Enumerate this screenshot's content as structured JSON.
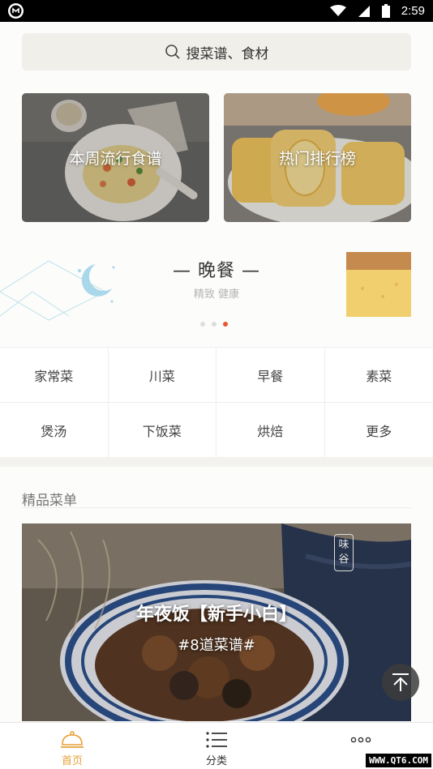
{
  "status_bar": {
    "time": "2:59"
  },
  "search": {
    "placeholder": "搜菜谱、食材"
  },
  "promo_cards": [
    {
      "label": "本周流行食谱"
    },
    {
      "label": "热门排行榜"
    }
  ],
  "meal_banner": {
    "title": "— 晚餐 —",
    "subtitle": "精致 健康",
    "active_dot": 3,
    "dot_count": 3
  },
  "categories": [
    "家常菜",
    "川菜",
    "早餐",
    "素菜",
    "煲汤",
    "下饭菜",
    "烘焙",
    "更多"
  ],
  "section": {
    "title": "精品菜单"
  },
  "featured": {
    "title": "年夜饭【新手小白】",
    "subtitle": "#8道菜谱#",
    "seal_chars": [
      "味",
      "谷"
    ]
  },
  "bottom_nav": [
    {
      "label": "首页",
      "icon": "cloche-icon",
      "active": true
    },
    {
      "label": "分类",
      "icon": "list-icon",
      "active": false
    },
    {
      "label": "",
      "icon": "more-icon",
      "active": false
    }
  ],
  "watermark": "WWW.QT6.COM",
  "colors": {
    "accent": "#e6a138",
    "dot_active": "#e8572f"
  }
}
